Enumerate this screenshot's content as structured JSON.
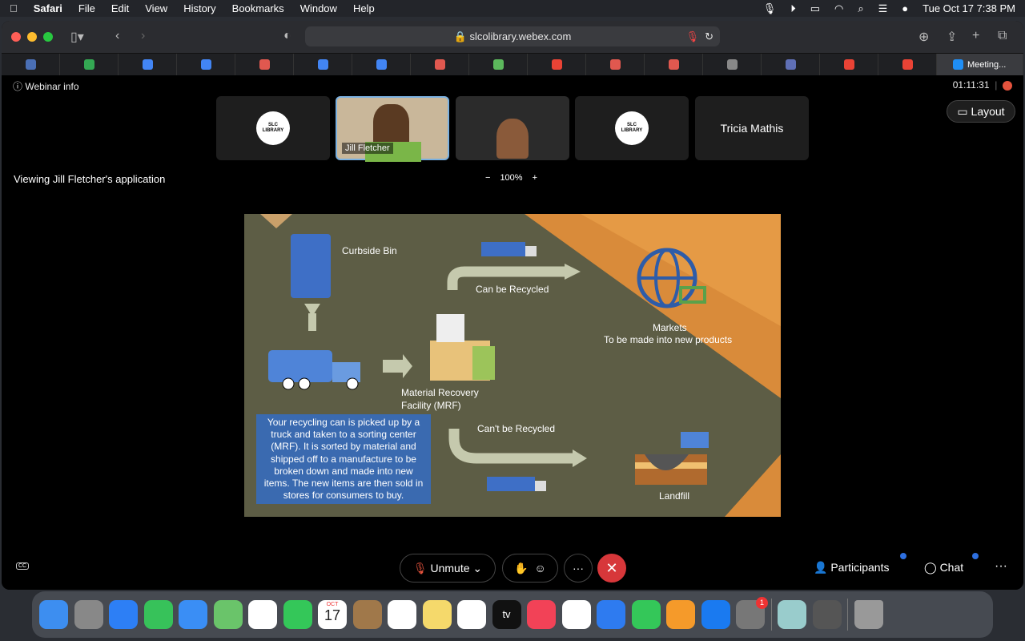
{
  "menubar": {
    "app": "Safari",
    "items": [
      "File",
      "Edit",
      "View",
      "History",
      "Bookmarks",
      "Window",
      "Help"
    ],
    "clock": "Tue Oct 17  7:38 PM"
  },
  "browser": {
    "url": "slcolibrary.webex.com",
    "active_tab": "Meeting...",
    "tab_colors": [
      "#4a6fb5",
      "#34a853",
      "#4285f4",
      "#4285f4",
      "#e0584f",
      "#4285f4",
      "#4285f4",
      "#e0584f",
      "#5cb85c",
      "#ea4335",
      "#e0584f",
      "#e0584f",
      "#888888",
      "#5f6fb5",
      "#ea4335",
      "#ea4335"
    ]
  },
  "webex": {
    "webinar_info": "Webinar info",
    "timer": "01:11:31",
    "viewing": "Viewing Jill Fletcher's application",
    "zoom": "100%",
    "participants": [
      {
        "name": "",
        "logo": "SALT LAKE COUNTY LIBRARY"
      },
      {
        "name": "Jill Fletcher"
      },
      {
        "name": ""
      },
      {
        "name": "",
        "logo": "SALT LAKE COUNTY LIBRARY"
      },
      {
        "name": "Tricia Mathis"
      }
    ],
    "layout": "Layout",
    "unmute": "Unmute",
    "participants_label": "Participants",
    "chat": "Chat"
  },
  "slide": {
    "curbside": "Curbside Bin",
    "can": "Can be Recycled",
    "cant": "Can't be Recycled",
    "mrf1": "Material Recovery",
    "mrf2": "Facility (MRF)",
    "markets": "Markets",
    "markets2": "To be made into new products",
    "landfill": "Landfill",
    "desc": "Your recycling can is picked up by a truck and taken to a sorting center (MRF).  It is sorted by material and shipped off to a manufacture to be broken down and made into new items. The new items are then sold in stores for consumers to buy."
  },
  "dock": {
    "apps": [
      "finder",
      "launchpad",
      "safari",
      "messages",
      "mail",
      "maps",
      "photos",
      "facetime",
      "calendar",
      "contacts",
      "reminders",
      "notes",
      "freeform",
      "tv",
      "music",
      "news",
      "keynote",
      "numbers",
      "pages",
      "app-store",
      "system-settings"
    ],
    "colors": [
      "#3d8ef0",
      "#888",
      "#2d7ff5",
      "#37c25a",
      "#3a8ef5",
      "#6ac46a",
      "#fff",
      "#34c759",
      "#fff",
      "#a0784a",
      "#fff",
      "#f5d96b",
      "#fff",
      "#111",
      "#f24257",
      "#fff",
      "#2e7bf0",
      "#34c759",
      "#f59a2a",
      "#1a7af0",
      "#777"
    ],
    "calendar_month": "OCT",
    "calendar_day": "17",
    "tv": "tv",
    "badge": "1"
  }
}
